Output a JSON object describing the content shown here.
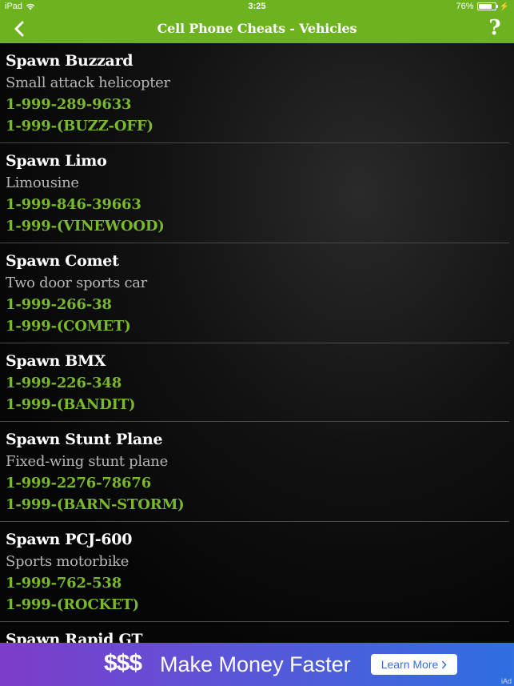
{
  "status_bar": {
    "device": "iPad",
    "time": "3:25",
    "battery": "76%"
  },
  "nav": {
    "title": "Cell Phone Cheats - Vehicles",
    "help_label": "?"
  },
  "cheats": [
    {
      "title": "Spawn Buzzard",
      "description": "Small attack helicopter",
      "number": "1-999-289-9633",
      "word": "1-999-(BUZZ-OFF)"
    },
    {
      "title": "Spawn Limo",
      "description": "Limousine",
      "number": "1-999-846-39663",
      "word": "1-999-(VINEWOOD)"
    },
    {
      "title": "Spawn Comet",
      "description": "Two door sports car",
      "number": "1-999-266-38",
      "word": "1-999-(COMET)"
    },
    {
      "title": "Spawn BMX",
      "description": "",
      "number": "1-999-226-348",
      "word": "1-999-(BANDIT)"
    },
    {
      "title": "Spawn Stunt Plane",
      "description": "Fixed-wing stunt plane",
      "number": "1-999-2276-78676",
      "word": "1-999-(BARN-STORM)"
    },
    {
      "title": "Spawn PCJ-600",
      "description": "Sports motorbike",
      "number": "1-999-762-538",
      "word": "1-999-(ROCKET)"
    },
    {
      "title": "Spawn Rapid GT",
      "description": "",
      "number": "",
      "word": ""
    }
  ],
  "ad": {
    "dollar_icon": "$$$",
    "headline": "Make Money Faster",
    "button_label": "Learn More",
    "ad_label": "iAd"
  },
  "colors": {
    "bar_green": "#6db31f",
    "code_green": "#78b82a"
  }
}
